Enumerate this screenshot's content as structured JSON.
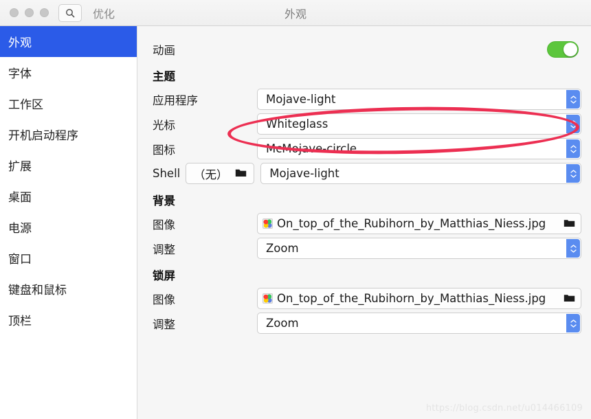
{
  "titlebar": {
    "app_name": "优化",
    "window_title": "外观",
    "search_icon": "search-icon",
    "traffic_lights": [
      "close",
      "minimize",
      "maximize"
    ]
  },
  "sidebar": {
    "items": [
      {
        "label": "外观",
        "selected": true
      },
      {
        "label": "字体",
        "selected": false
      },
      {
        "label": "工作区",
        "selected": false
      },
      {
        "label": "开机启动程序",
        "selected": false
      },
      {
        "label": "扩展",
        "selected": false
      },
      {
        "label": "桌面",
        "selected": false
      },
      {
        "label": "电源",
        "selected": false
      },
      {
        "label": "窗口",
        "selected": false
      },
      {
        "label": "键盘和鼠标",
        "selected": false
      },
      {
        "label": "顶栏",
        "selected": false
      }
    ]
  },
  "content": {
    "animation": {
      "label": "动画",
      "toggle_state": "on",
      "toggle_color": "#5cc63c"
    },
    "theme": {
      "heading": "主题",
      "application": {
        "label": "应用程序",
        "value": "Mojave-light"
      },
      "cursor": {
        "label": "光标",
        "value": "Whiteglass"
      },
      "icons": {
        "label": "图标",
        "value": "McMojave-circle"
      },
      "shell": {
        "label": "Shell",
        "button_value": "（无）",
        "button_icon": "folder-icon",
        "value": "Mojave-light"
      }
    },
    "background": {
      "heading": "背景",
      "image": {
        "label": "图像",
        "value": "On_top_of_the_Rubihorn_by_Matthias_Niess.jpg",
        "thumb_icon": "image-thumbnail-icon",
        "folder_icon": "folder-icon"
      },
      "adjust": {
        "label": "调整",
        "value": "Zoom"
      }
    },
    "lockscreen": {
      "heading": "锁屏",
      "image": {
        "label": "图像",
        "value": "On_top_of_the_Rubihorn_by_Matthias_Niess.jpg",
        "thumb_icon": "image-thumbnail-icon",
        "folder_icon": "folder-icon"
      },
      "adjust": {
        "label": "调整",
        "value": "Zoom"
      }
    }
  },
  "annotation": {
    "ellipse_color": "#ec2f52",
    "target": "图标 / McMojave-circle"
  },
  "watermark": {
    "text": "https://blog.csdn.net/u014466109"
  },
  "colors": {
    "sidebar_selected": "#2b5be8",
    "stepper": "#5a8cf0",
    "toggle_on": "#5cc63c",
    "annotation": "#ec2f52"
  }
}
